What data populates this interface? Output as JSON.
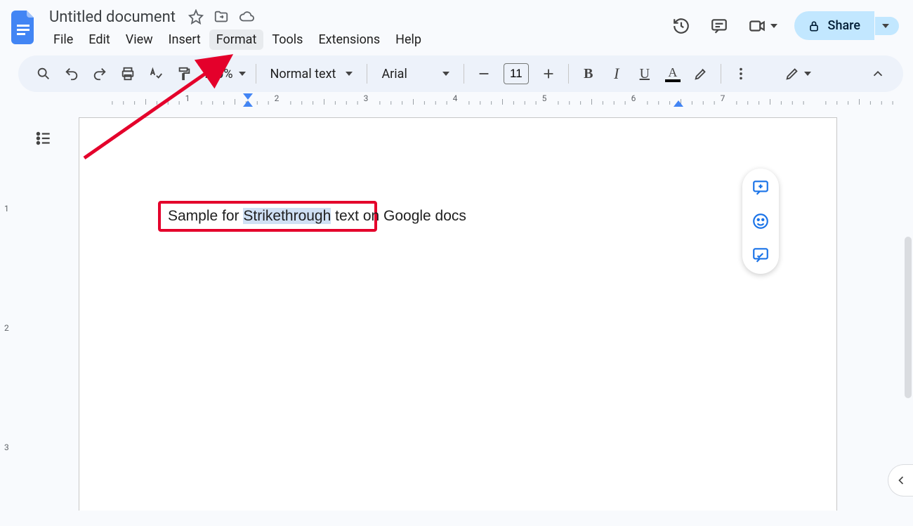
{
  "header": {
    "doc_title": "Untitled document",
    "menu": {
      "file": "File",
      "edit": "Edit",
      "view": "View",
      "insert": "Insert",
      "format": "Format",
      "tools": "Tools",
      "extensions": "Extensions",
      "help": "Help"
    },
    "share_label": "Share"
  },
  "toolbar": {
    "zoom": "100%",
    "paragraph_style": "Normal text",
    "font_family": "Arial",
    "font_size": "11",
    "bold_glyph": "B",
    "italic_glyph": "I",
    "underline_glyph": "U",
    "textcolor_glyph": "A"
  },
  "ruler": {
    "h_numbers": [
      "1",
      "2",
      "3",
      "4",
      "5",
      "6",
      "7"
    ],
    "v_numbers": [
      "1",
      "2",
      "3"
    ]
  },
  "document": {
    "text_before": "Sample for ",
    "text_selected": "Strikethrough",
    "text_after": " text on Google docs"
  },
  "annotation": {
    "highlighted_menu": "format"
  }
}
